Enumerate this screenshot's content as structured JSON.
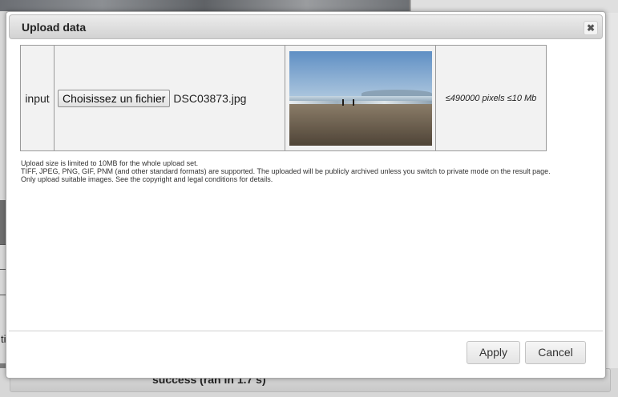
{
  "background": {
    "status_text": "success (ran in 1.7 s)",
    "left_fragment": "ti"
  },
  "dialog": {
    "title": "Upload data",
    "close_glyph": "✖",
    "row": {
      "label": "input",
      "file_button": "Choisissez un fichier",
      "file_name": "DSC03873.jpg",
      "limit": "≤490000 pixels ≤10 Mb"
    },
    "notes": [
      "Upload size is limited to 10MB for the whole upload set.",
      "TIFF, JPEG, PNG, GIF, PNM (and other standard formats) are supported. The uploaded will be publicly archived unless you switch to private mode on the result page.",
      "Only upload suitable images. See the copyright and legal conditions for details."
    ],
    "buttons": {
      "apply": "Apply",
      "cancel": "Cancel"
    }
  },
  "icons": {
    "close": "close-icon"
  },
  "colors": {
    "overlay": "#7d7d7d",
    "titlebar": "#dcdcdc",
    "table_bg": "#f2f2f2"
  }
}
